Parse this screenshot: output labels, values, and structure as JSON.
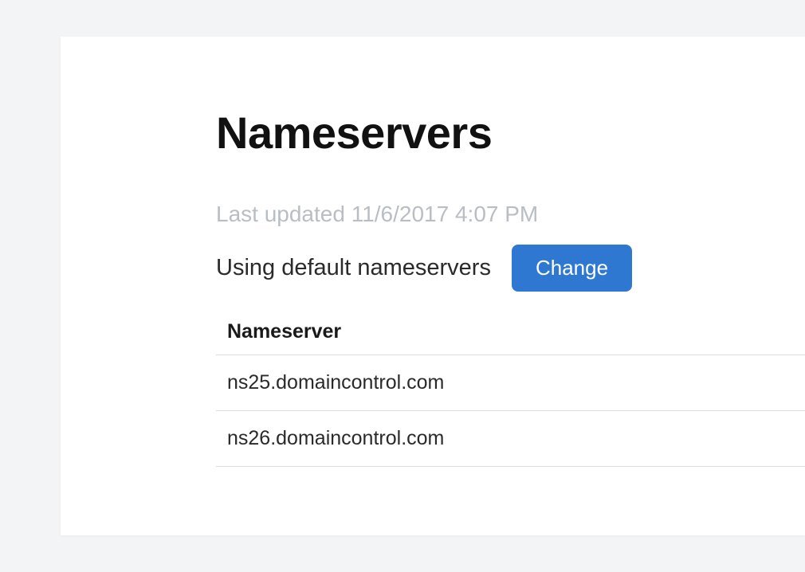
{
  "header": {
    "title": "Nameservers",
    "last_updated": "Last updated 11/6/2017 4:07 PM"
  },
  "status": {
    "text": "Using default nameservers",
    "change_button": "Change"
  },
  "table": {
    "header": "Nameserver",
    "rows": [
      "ns25.domaincontrol.com",
      "ns26.domaincontrol.com"
    ]
  }
}
